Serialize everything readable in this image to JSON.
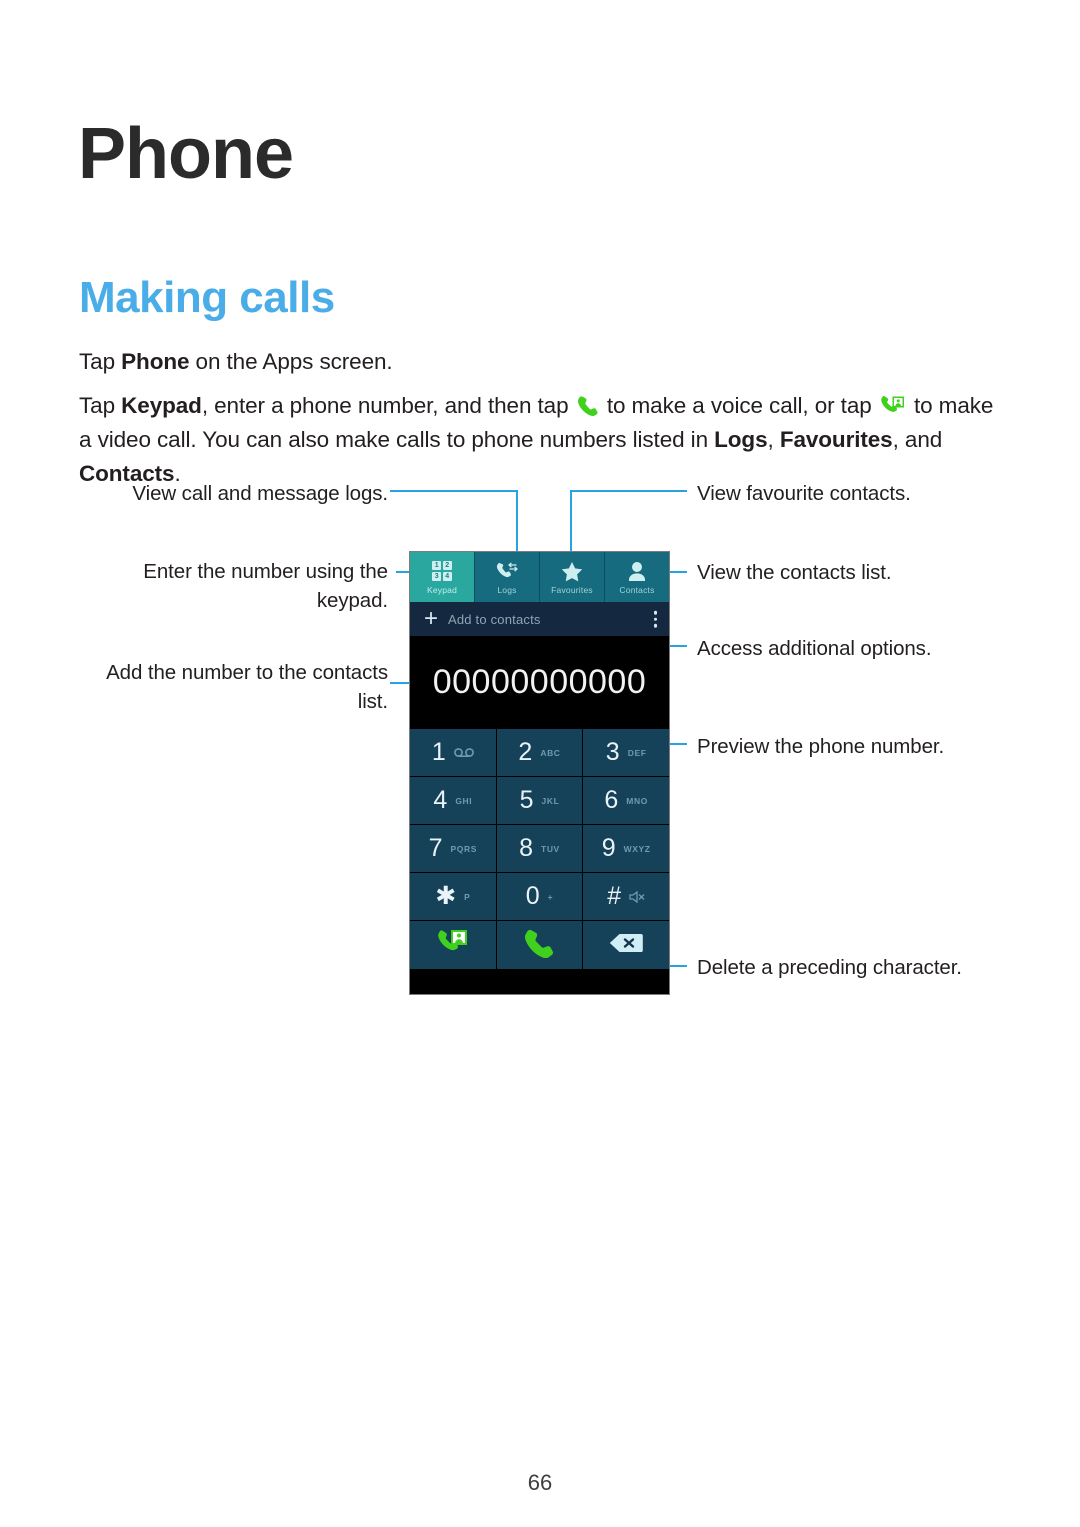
{
  "document": {
    "chapter_title": "Phone",
    "section_title": "Making calls",
    "page_number": "66"
  },
  "paragraphs": {
    "p1": {
      "part1": "Tap ",
      "bold1": "Phone",
      "part2": " on the Apps screen."
    },
    "p2": {
      "part1": "Tap ",
      "bold1": "Keypad",
      "part2": ", enter a phone number, and then tap ",
      "icon1": "phone-handset-icon",
      "part3": " to make a voice call, or tap ",
      "icon2": "video-call-icon",
      "part4": " to make a video call. You can also make calls to phone numbers listed in ",
      "bold2": "Logs",
      "part5": ", ",
      "bold3": "Favourites",
      "part6": ", and ",
      "bold4": "Contacts",
      "part7": "."
    }
  },
  "callouts": {
    "view_logs": "View call and message logs.",
    "enter_number": "Enter the number using the\nkeypad.",
    "add_contacts": "Add the number to the contacts\nlist.",
    "view_favourites": "View favourite contacts.",
    "view_contacts": "View the contacts list.",
    "access_options": "Access additional options.",
    "preview_number": "Preview the phone number.",
    "delete_char": "Delete a preceding character."
  },
  "phone_ui": {
    "tabs": [
      {
        "label": "Keypad",
        "icon": "keypad-grid-icon",
        "active": true
      },
      {
        "label": "Logs",
        "icon": "call-logs-icon",
        "active": false
      },
      {
        "label": "Favourites",
        "icon": "star-icon",
        "active": false
      },
      {
        "label": "Contacts",
        "icon": "person-icon",
        "active": false
      }
    ],
    "keypad_grid_digits": [
      "1",
      "2",
      "3",
      "4"
    ],
    "add_bar": {
      "plus": "+",
      "label": "Add to contacts",
      "overflow_icon": "kebab-menu-icon"
    },
    "number_display": "00000000000",
    "keys": [
      {
        "digit": "1",
        "letters": "",
        "glyph": "voicemail"
      },
      {
        "digit": "2",
        "letters": "ABC",
        "glyph": ""
      },
      {
        "digit": "3",
        "letters": "DEF",
        "glyph": ""
      },
      {
        "digit": "4",
        "letters": "GHI",
        "glyph": ""
      },
      {
        "digit": "5",
        "letters": "JKL",
        "glyph": ""
      },
      {
        "digit": "6",
        "letters": "MNO",
        "glyph": ""
      },
      {
        "digit": "7",
        "letters": "PQRS",
        "glyph": ""
      },
      {
        "digit": "8",
        "letters": "TUV",
        "glyph": ""
      },
      {
        "digit": "9",
        "letters": "WXYZ",
        "glyph": ""
      },
      {
        "digit": "✱",
        "letters": "P",
        "glyph": ""
      },
      {
        "digit": "0",
        "letters": "+",
        "glyph": ""
      },
      {
        "digit": "#",
        "letters": "",
        "glyph": "silent"
      }
    ],
    "actions": [
      {
        "name": "video-call-button",
        "icon": "video-call-icon"
      },
      {
        "name": "voice-call-button",
        "icon": "phone-handset-icon"
      },
      {
        "name": "backspace-button",
        "icon": "backspace-icon"
      }
    ]
  },
  "colors": {
    "accent_blue": "#4aade8",
    "leader_blue": "#29a3e0",
    "tab_active": "#2aa79e",
    "tab_inactive": "#176b7e",
    "key_bg": "#154159",
    "call_green": "#3fd11e",
    "backspace_blue": "#cfeef5"
  }
}
